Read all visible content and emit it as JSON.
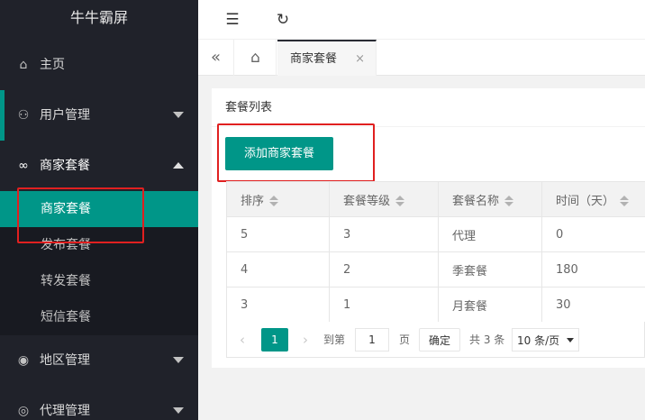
{
  "sidebar": {
    "logo": "牛牛霸屏",
    "items": [
      {
        "label": "主页",
        "icon": "home-icon"
      },
      {
        "label": "用户管理",
        "icon": "user-icon"
      },
      {
        "label": "商家套餐",
        "icon": "link-icon"
      },
      {
        "label": "地区管理",
        "icon": "compass-icon"
      },
      {
        "label": "代理管理",
        "icon": "agent-icon"
      }
    ],
    "submenu": [
      "商家套餐",
      "发布套餐",
      "转发套餐",
      "短信套餐"
    ]
  },
  "header": {
    "collapse_icon": "indent-icon",
    "refresh_icon": "refresh-icon"
  },
  "tabs": {
    "active_label": "商家套餐",
    "close": "×"
  },
  "card": {
    "title": "套餐列表",
    "add_button": "添加商家套餐"
  },
  "table": {
    "columns": [
      "排序",
      "套餐等级",
      "套餐名称",
      "时间（天）"
    ],
    "rows": [
      [
        "5",
        "3",
        "代理",
        "0"
      ],
      [
        "4",
        "2",
        "季套餐",
        "180"
      ],
      [
        "3",
        "1",
        "月套餐",
        "30"
      ]
    ]
  },
  "pagination": {
    "current": "1",
    "goto_label": "到第",
    "goto_value": "1",
    "page_label": "页",
    "confirm": "确定",
    "total": "共 3 条",
    "page_size": "10 条/页"
  },
  "colors": {
    "accent": "#009688",
    "sidebar_bg": "#20222a",
    "highlight": "#e02020"
  }
}
